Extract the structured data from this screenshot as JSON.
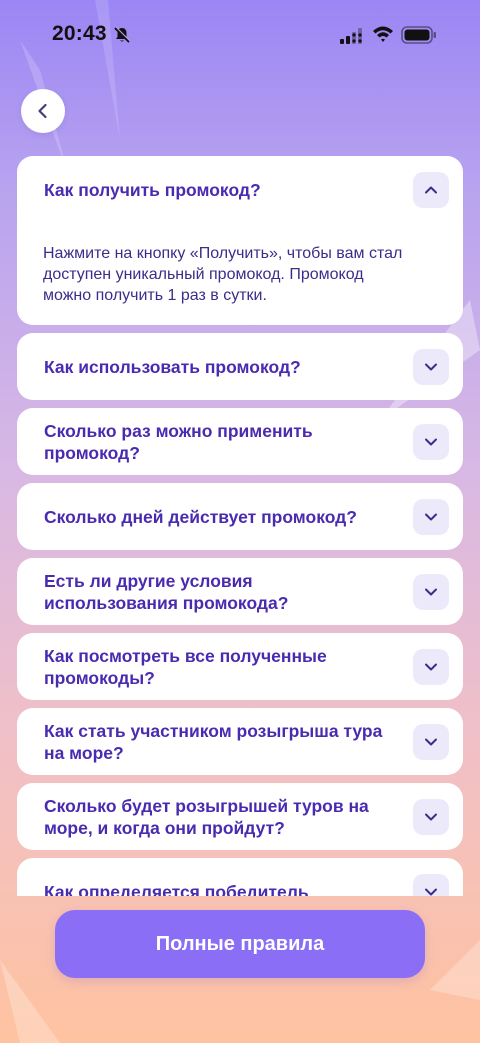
{
  "status_bar": {
    "time": "20:43",
    "icons": [
      "mute-icon",
      "signal-icon",
      "wifi-icon",
      "battery-icon"
    ]
  },
  "header": {
    "back_icon": "chevron-left-icon"
  },
  "faq": {
    "items": [
      {
        "question": "Как получить промокод?",
        "answer": "Нажмите на кнопку «Получить», чтобы вам стал доступен уникальный промокод. Промокод можно получить 1 раз в сутки.",
        "expanded": true
      },
      {
        "question": "Как использовать промокод?",
        "expanded": false
      },
      {
        "question": "Сколько раз можно применить промокод?",
        "expanded": false
      },
      {
        "question": "Сколько дней действует промокод?",
        "expanded": false
      },
      {
        "question": "Есть ли другие условия использования промокода?",
        "expanded": false
      },
      {
        "question": "Как посмотреть все полученные промокоды?",
        "expanded": false
      },
      {
        "question": "Как стать участником розыгрыша тура на море?",
        "expanded": false
      },
      {
        "question": "Сколько будет розыгрышей туров на море, и когда они пройдут?",
        "expanded": false
      },
      {
        "question": "Как определяется победитель",
        "expanded": false
      }
    ]
  },
  "footer": {
    "full_rules_label": "Полные правила"
  },
  "colors": {
    "accent": "#8a6ef5",
    "question_text": "#4a2bb0",
    "chevron_bg": "#ece9fb"
  }
}
